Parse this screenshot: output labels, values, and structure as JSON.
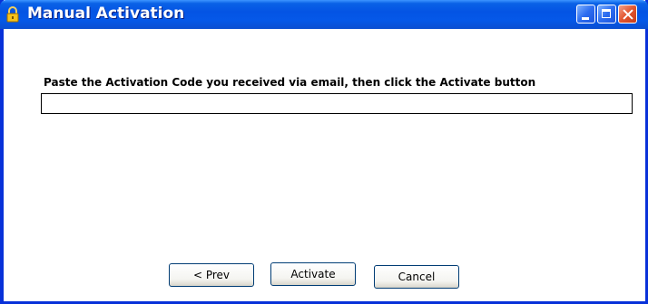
{
  "window": {
    "title": "Manual Activation",
    "icon": "lock-icon"
  },
  "form": {
    "prompt": "Paste the Activation Code you received via email, then click the Activate button",
    "code_value": ""
  },
  "buttons": {
    "prev": "< Prev",
    "activate": "Activate",
    "cancel": "Cancel"
  },
  "colors": {
    "titlebar": "#0454e4",
    "frame": "#0831d9",
    "close": "#e2552e"
  }
}
